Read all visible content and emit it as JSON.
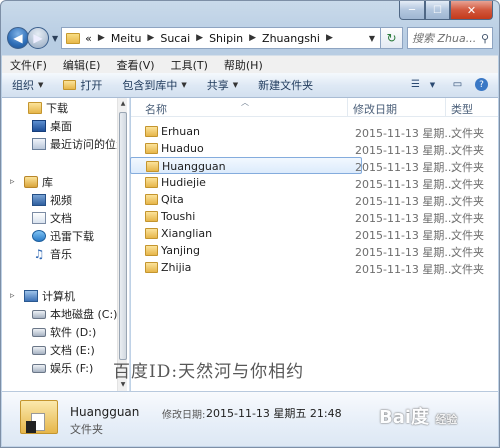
{
  "window": {
    "min_glyph": "─",
    "max_glyph": "☐",
    "close_glyph": "✕"
  },
  "nav": {
    "back_glyph": "◀",
    "forward_glyph": "▶",
    "history_glyph": "▼",
    "breadcrumb_prefix": "«",
    "path": [
      "Meitu",
      "Sucai",
      "Shipin",
      "Zhuangshi"
    ],
    "sep_glyph": "▶",
    "addr_dropdown_glyph": "▼",
    "refresh_glyph": "↻",
    "search_placeholder": "搜索 Zhua...",
    "search_icon": "search-icon"
  },
  "menubar": [
    "文件(F)",
    "编辑(E)",
    "查看(V)",
    "工具(T)",
    "帮助(H)"
  ],
  "toolbar": {
    "organize": "组织",
    "open": "打开",
    "include": "包含到库中",
    "share": "共享",
    "new_folder": "新建文件夹",
    "dropdown_glyph": "▼",
    "view_glyph": "☰",
    "pane_glyph": "▭",
    "help_glyph": "?"
  },
  "sidebar": {
    "items": [
      {
        "label": "下载",
        "icon": "ico-folder"
      },
      {
        "label": "桌面",
        "icon": "ico-desktop"
      },
      {
        "label": "最近访问的位置",
        "icon": "ico-recent"
      },
      {
        "label": "库",
        "icon": "ico-library"
      },
      {
        "label": "视频",
        "icon": "ico-video"
      },
      {
        "label": "文档",
        "icon": "ico-doc"
      },
      {
        "label": "迅雷下载",
        "icon": "ico-xunlei"
      },
      {
        "label": "音乐",
        "icon": "ico-music"
      },
      {
        "label": "计算机",
        "icon": "ico-computer"
      },
      {
        "label": "本地磁盘 (C:)",
        "icon": "ico-drive"
      },
      {
        "label": "软件 (D:)",
        "icon": "ico-drive"
      },
      {
        "label": "文档 (E:)",
        "icon": "ico-drive"
      },
      {
        "label": "娱乐 (F:)",
        "icon": "ico-drive"
      }
    ],
    "expander_glyph": "▹"
  },
  "columns": {
    "name": "名称",
    "date": "修改日期",
    "type": "类型",
    "sort_glyph": "︿"
  },
  "files": [
    {
      "name": "Erhuan",
      "date": "2015-11-13 星期...",
      "type": "文件夹"
    },
    {
      "name": "Huaduo",
      "date": "2015-11-13 星期...",
      "type": "文件夹"
    },
    {
      "name": "Huangguan",
      "date": "2015-11-13 星期...",
      "type": "文件夹"
    },
    {
      "name": "Hudiejie",
      "date": "2015-11-13 星期...",
      "type": "文件夹"
    },
    {
      "name": "Qita",
      "date": "2015-11-13 星期...",
      "type": "文件夹"
    },
    {
      "name": "Toushi",
      "date": "2015-11-13 星期...",
      "type": "文件夹"
    },
    {
      "name": "Xianglian",
      "date": "2015-11-13 星期...",
      "type": "文件夹"
    },
    {
      "name": "Yanjing",
      "date": "2015-11-13 星期...",
      "type": "文件夹"
    },
    {
      "name": "Zhijia",
      "date": "2015-11-13 星期...",
      "type": "文件夹"
    }
  ],
  "selected_index": 2,
  "details": {
    "name": "Huangguan",
    "modified_label": "修改日期:",
    "modified_value": "2015-11-13 星期五 21:48",
    "type": "文件夹"
  },
  "watermark": {
    "text": "百度ID:天然河与你相约",
    "logo": "Bai度",
    "logo_sub": "经验"
  }
}
